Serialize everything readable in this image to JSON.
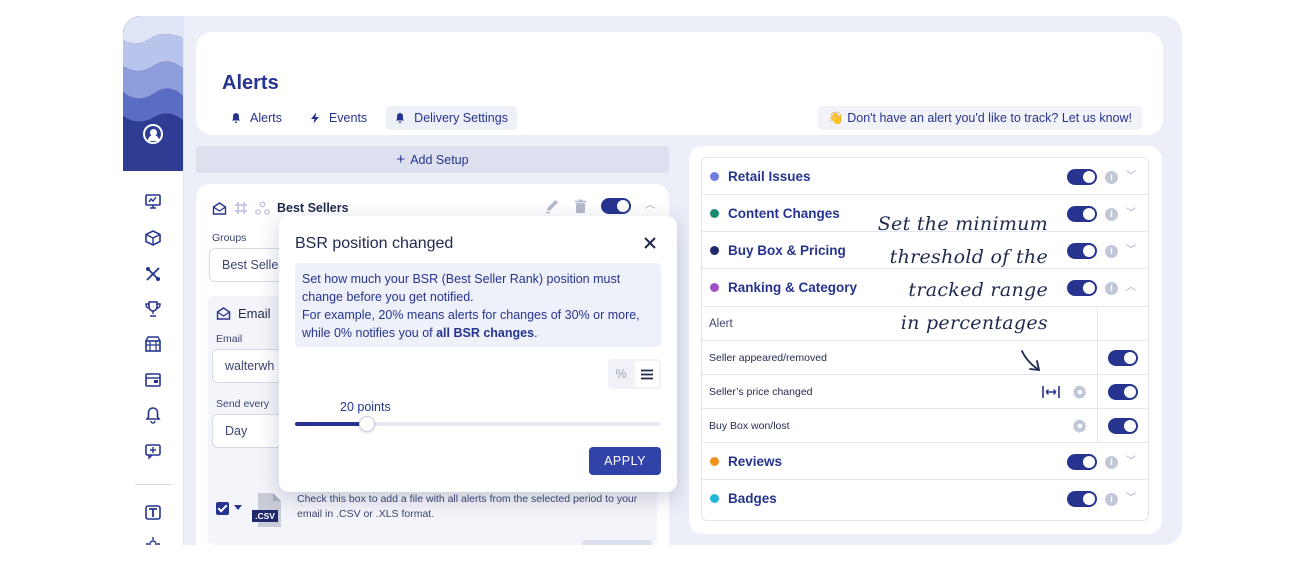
{
  "header": {
    "title": "Alerts",
    "tabs": [
      {
        "label": "Alerts",
        "icon": "bell-icon"
      },
      {
        "label": "Events",
        "icon": "bolt-icon"
      },
      {
        "label": "Delivery Settings",
        "icon": "bell-icon",
        "active": true
      }
    ],
    "feedback": "👋 Don't have an alert you'd like to track? Let us know!"
  },
  "left": {
    "add_setup": "Add Setup",
    "setup_name": "Best Sellers",
    "groups_label": "Groups",
    "groups_value": "Best Seller",
    "email_section": "Email",
    "email_label": "Email",
    "email_value": "walterwh",
    "send_every_label": "Send every",
    "send_every_value": "Day",
    "csv_badge": ".CSV",
    "csv_text": "Check this box to add a file with all alerts from the selected period to your email in .CSV or .XLS format."
  },
  "popup": {
    "title": "BSR position changed",
    "info_line1": "Set how much your BSR (Best Seller Rank) position must change before you get notified.",
    "info_line2_a": "For example, 20% means alerts for changes of 30% or more, while 0% notifies you of ",
    "info_line2_bold": "all BSR changes",
    "info_line2_end": ".",
    "unit_percent": "%",
    "slider_label": "20 points",
    "slider_fraction": 0.196,
    "apply": "APPLY"
  },
  "right": {
    "categories": [
      {
        "label": "Retail Issues",
        "color": "#6f7fe0",
        "expanded": false
      },
      {
        "label": "Content Changes",
        "color": "#1a8a6f",
        "expanded": false
      },
      {
        "label": "Buy Box & Pricing",
        "color": "#1f2a6e",
        "expanded": false
      },
      {
        "label": "Ranking & Category",
        "color": "#a24fc4",
        "expanded": true
      }
    ],
    "sub_header": "Alert",
    "sub_rows": [
      {
        "label": "Seller appeared/removed",
        "range": false,
        "gear": false
      },
      {
        "label": "Seller’s price changed",
        "range": true,
        "gear": true
      },
      {
        "label": "Buy Box won/lost",
        "range": false,
        "gear": true
      }
    ],
    "more_categories": [
      {
        "label": "Reviews",
        "color": "#f4901e"
      },
      {
        "label": "Badges",
        "color": "#20b8d8"
      }
    ],
    "info_glyph": "i"
  },
  "annotation": {
    "line1": "Set the minimum",
    "line2": "threshold of the",
    "line3": "tracked range",
    "line4": "in percentages"
  }
}
